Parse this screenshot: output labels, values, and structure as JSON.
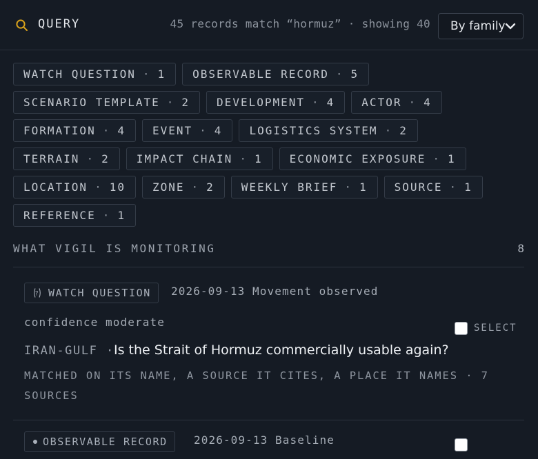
{
  "header": {
    "title": "QUERY",
    "match_summary": "45 records match “hormuz” · showing 40",
    "sort_value": "By family",
    "accent_color": "#d9a21b"
  },
  "filters": [
    {
      "label": "WATCH QUESTION",
      "count": "1"
    },
    {
      "label": "OBSERVABLE RECORD",
      "count": "5"
    },
    {
      "label": "SCENARIO TEMPLATE",
      "count": "2"
    },
    {
      "label": "DEVELOPMENT",
      "count": "4"
    },
    {
      "label": "ACTOR",
      "count": "4"
    },
    {
      "label": "FORMATION",
      "count": "4"
    },
    {
      "label": "EVENT",
      "count": "4"
    },
    {
      "label": "LOGISTICS SYSTEM",
      "count": "2"
    },
    {
      "label": "TERRAIN",
      "count": "2"
    },
    {
      "label": "IMPACT CHAIN",
      "count": "1"
    },
    {
      "label": "ECONOMIC EXPOSURE",
      "count": "1"
    },
    {
      "label": "LOCATION",
      "count": "10"
    },
    {
      "label": "ZONE",
      "count": "2"
    },
    {
      "label": "WEEKLY BRIEF",
      "count": "1"
    },
    {
      "label": "SOURCE",
      "count": "1"
    },
    {
      "label": "REFERENCE",
      "count": "1"
    }
  ],
  "section": {
    "title": "WHAT VIGIL IS MONITORING",
    "count": "8"
  },
  "results": [
    {
      "type_label": "WATCH QUESTION",
      "type_icon": "question-circle-icon",
      "meta": "2026-09-13 Movement observed",
      "confidence": "confidence moderate",
      "select_label": "SELECT",
      "region": "IRAN-GULF",
      "separator": "·",
      "title": "Is the Strait of Hormuz commercially usable again?",
      "matched": "MATCHED ON ITS NAME, A SOURCE IT CITES, A PLACE IT NAMES · 7 SOURCES"
    },
    {
      "type_label": "OBSERVABLE RECORD",
      "type_icon": "dot-icon",
      "meta": "2026-09-13 Baseline"
    }
  ]
}
